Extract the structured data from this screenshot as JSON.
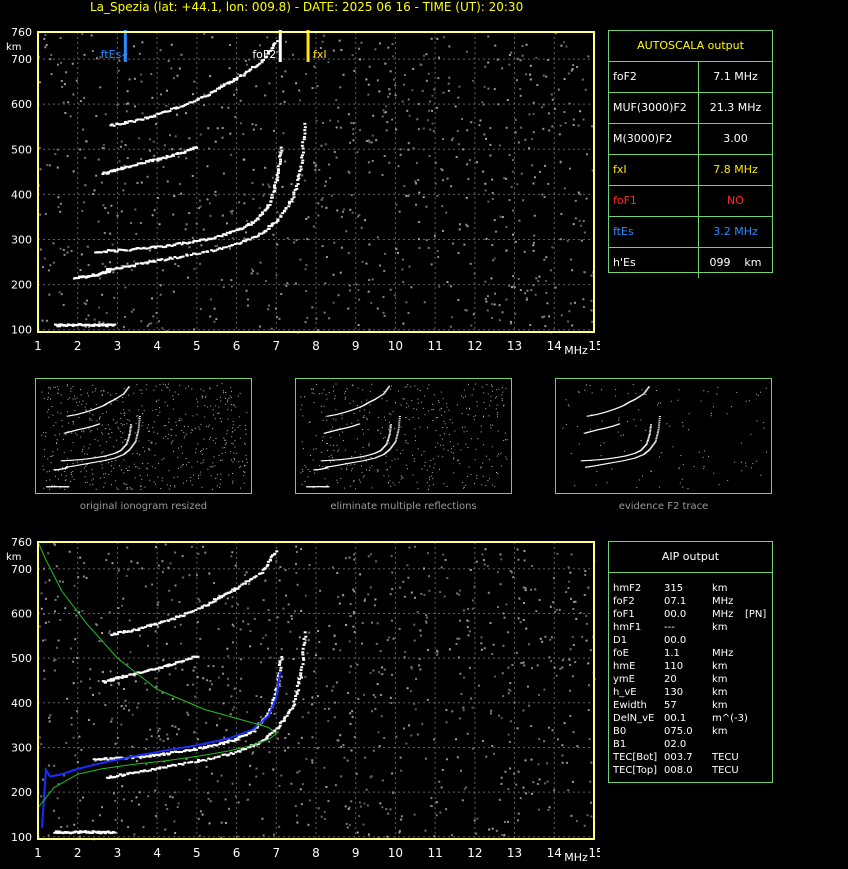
{
  "header": {
    "title": "La_Spezia (lat: +44.1, lon: 009.8) - DATE: 2025 06 16 - TIME (UT): 20:30"
  },
  "colors": {
    "axis": "#ffff80",
    "grid": "#606060",
    "panel_border": "#6fd26f",
    "ftEs": "#2a8cff",
    "fxI": "#ffe400",
    "foF1": "#ff2a2a",
    "blue_profile": "#1a2cff",
    "green_profile": "#20c020"
  },
  "chart_data": [
    {
      "type": "scatter",
      "title": "",
      "x_unit_label": "MHz",
      "y_unit_label": "km",
      "xlim": [
        1,
        15
      ],
      "ylim": [
        95,
        760
      ],
      "x_ticks": [
        1,
        2,
        3,
        4,
        5,
        6,
        7,
        8,
        9,
        10,
        11,
        12,
        13,
        14,
        15
      ],
      "y_ticks": [
        100,
        200,
        300,
        400,
        500,
        600,
        700,
        760
      ],
      "grid": true,
      "markers": [
        {
          "name": "ftEs",
          "x": 3.2,
          "color": "#2a8cff"
        },
        {
          "name": "foF2",
          "x": 7.1,
          "color": "#ffffff"
        },
        {
          "name": "fxI",
          "x": 7.8,
          "color": "#ffe400"
        }
      ],
      "series": [
        {
          "x": [
            1.4,
            1.8,
            2.2,
            2.6,
            2.9
          ],
          "y": [
            112,
            112,
            113,
            112,
            112
          ]
        },
        {
          "x": [
            1.9,
            2.2,
            2.5,
            2.8
          ],
          "y": [
            218,
            220,
            225,
            232
          ]
        },
        {
          "x": [
            2.4,
            3.0,
            3.6,
            4.2,
            4.8,
            5.4,
            6.0,
            6.4,
            6.8,
            7.0,
            7.1
          ],
          "y": [
            275,
            278,
            282,
            288,
            296,
            306,
            322,
            340,
            380,
            440,
            510
          ]
        },
        {
          "x": [
            2.7,
            3.2,
            3.8,
            4.4,
            5.2,
            6.0,
            6.6,
            7.0,
            7.4,
            7.6,
            7.7
          ],
          "y": [
            235,
            242,
            252,
            262,
            275,
            292,
            315,
            345,
            395,
            470,
            565
          ]
        },
        {
          "x": [
            2.6,
            3.0,
            3.5,
            4.0,
            4.5,
            5.0
          ],
          "y": [
            448,
            458,
            470,
            480,
            492,
            508
          ]
        },
        {
          "x": [
            2.8,
            3.4,
            4.0,
            4.6,
            5.2,
            5.6,
            6.0,
            6.6,
            7.0
          ],
          "y": [
            555,
            565,
            580,
            598,
            620,
            642,
            660,
            695,
            745
          ]
        }
      ]
    },
    {
      "type": "scatter",
      "title": "",
      "x_unit_label": "MHz",
      "y_unit_label": "km",
      "xlim": [
        1,
        15
      ],
      "ylim": [
        95,
        760
      ],
      "x_ticks": [
        1,
        2,
        3,
        4,
        5,
        6,
        7,
        8,
        9,
        10,
        11,
        12,
        13,
        14,
        15
      ],
      "y_ticks": [
        100,
        200,
        300,
        400,
        500,
        600,
        700,
        760
      ],
      "grid": true,
      "series": [
        {
          "x": [
            1.4,
            1.8,
            2.2,
            2.6,
            2.9
          ],
          "y": [
            112,
            112,
            113,
            112,
            112
          ]
        },
        {
          "x": [
            2.4,
            3.0,
            3.6,
            4.2,
            4.8,
            5.4,
            6.0,
            6.4,
            6.8,
            7.0,
            7.1
          ],
          "y": [
            275,
            278,
            282,
            288,
            296,
            306,
            322,
            340,
            380,
            440,
            510
          ]
        },
        {
          "x": [
            2.7,
            3.2,
            3.8,
            4.4,
            5.2,
            6.0,
            6.6,
            7.0,
            7.4,
            7.6,
            7.7
          ],
          "y": [
            235,
            242,
            252,
            262,
            275,
            292,
            315,
            345,
            395,
            470,
            565
          ]
        },
        {
          "x": [
            2.6,
            3.0,
            3.5,
            4.0,
            4.5,
            5.0
          ],
          "y": [
            448,
            458,
            470,
            480,
            492,
            508
          ]
        },
        {
          "x": [
            2.8,
            3.4,
            4.0,
            4.6,
            5.2,
            5.6,
            6.0,
            6.6,
            7.0
          ],
          "y": [
            555,
            565,
            580,
            598,
            620,
            642,
            660,
            695,
            745
          ]
        }
      ],
      "profiles": [
        {
          "color": "#1a2cff",
          "x": [
            1.1,
            1.2,
            1.3,
            1.6,
            2.0,
            2.6,
            3.4,
            4.2,
            5.0,
            5.8,
            6.4,
            6.8,
            7.0,
            7.1
          ],
          "y": [
            120,
            250,
            235,
            240,
            252,
            265,
            280,
            293,
            305,
            320,
            340,
            370,
            410,
            470
          ]
        },
        {
          "color": "#20c020",
          "x": [
            1.0,
            1.4,
            2.0,
            2.6,
            3.4,
            4.2,
            5.0,
            5.8,
            6.4,
            6.8,
            7.0,
            6.8,
            6.2,
            5.2,
            4.0,
            3.0,
            2.2,
            1.6,
            1.2,
            1.0
          ],
          "y": [
            165,
            210,
            240,
            252,
            262,
            270,
            280,
            292,
            305,
            318,
            330,
            345,
            360,
            385,
            430,
            500,
            580,
            650,
            720,
            760
          ]
        }
      ]
    }
  ],
  "thumbnails": [
    {
      "caption": "original ionogram resized"
    },
    {
      "caption": "eliminate multiple reflections"
    },
    {
      "caption": "evidence F2 trace"
    }
  ],
  "autoscala": {
    "title": "AUTOSCALA output",
    "rows": [
      {
        "label": "foF2",
        "value": "7.1 MHz",
        "color": "#ffffff"
      },
      {
        "label": "MUF(3000)F2",
        "value": "21.3 MHz",
        "color": "#ffffff"
      },
      {
        "label": "M(3000)F2",
        "value": "3.00",
        "color": "#ffffff"
      },
      {
        "label": "fxI",
        "value": "7.8 MHz",
        "color": "#ffe400"
      },
      {
        "label": "foF1",
        "value": "NO",
        "color": "#ff2a2a"
      },
      {
        "label": "ftEs",
        "value": "3.2 MHz",
        "color": "#2a8cff"
      },
      {
        "label": "h'Es",
        "value": "099    km",
        "color": "#ffffff"
      }
    ]
  },
  "aip": {
    "title": "AIP output",
    "rows": [
      {
        "label": "hmF2",
        "value": "315",
        "unit": "km",
        "extra": ""
      },
      {
        "label": "foF2",
        "value": "07.1",
        "unit": "MHz",
        "extra": ""
      },
      {
        "label": "foF1",
        "value": "00.0",
        "unit": "MHz",
        "extra": "[PN]"
      },
      {
        "label": "hmF1",
        "value": "---",
        "unit": "km",
        "extra": ""
      },
      {
        "label": "D1",
        "value": "00.0",
        "unit": "",
        "extra": ""
      },
      {
        "label": "foE",
        "value": "1.1",
        "unit": "MHz",
        "extra": ""
      },
      {
        "label": "hmE",
        "value": "110",
        "unit": "km",
        "extra": ""
      },
      {
        "label": "ymE",
        "value": "20",
        "unit": "km",
        "extra": ""
      },
      {
        "label": "h_vE",
        "value": "130",
        "unit": "km",
        "extra": ""
      },
      {
        "label": "Ewidth",
        "value": "57",
        "unit": "km",
        "extra": ""
      },
      {
        "label": "DelN_vE",
        "value": "00.1",
        "unit": "m^(-3)",
        "extra": ""
      },
      {
        "label": "B0",
        "value": "075.0",
        "unit": "km",
        "extra": ""
      },
      {
        "label": "B1",
        "value": "02.0",
        "unit": "",
        "extra": ""
      },
      {
        "label": "TEC[Bot]",
        "value": "003.7",
        "unit": "TECU",
        "extra": ""
      },
      {
        "label": "TEC[Top]",
        "value": "008.0",
        "unit": "TECU",
        "extra": ""
      }
    ]
  }
}
